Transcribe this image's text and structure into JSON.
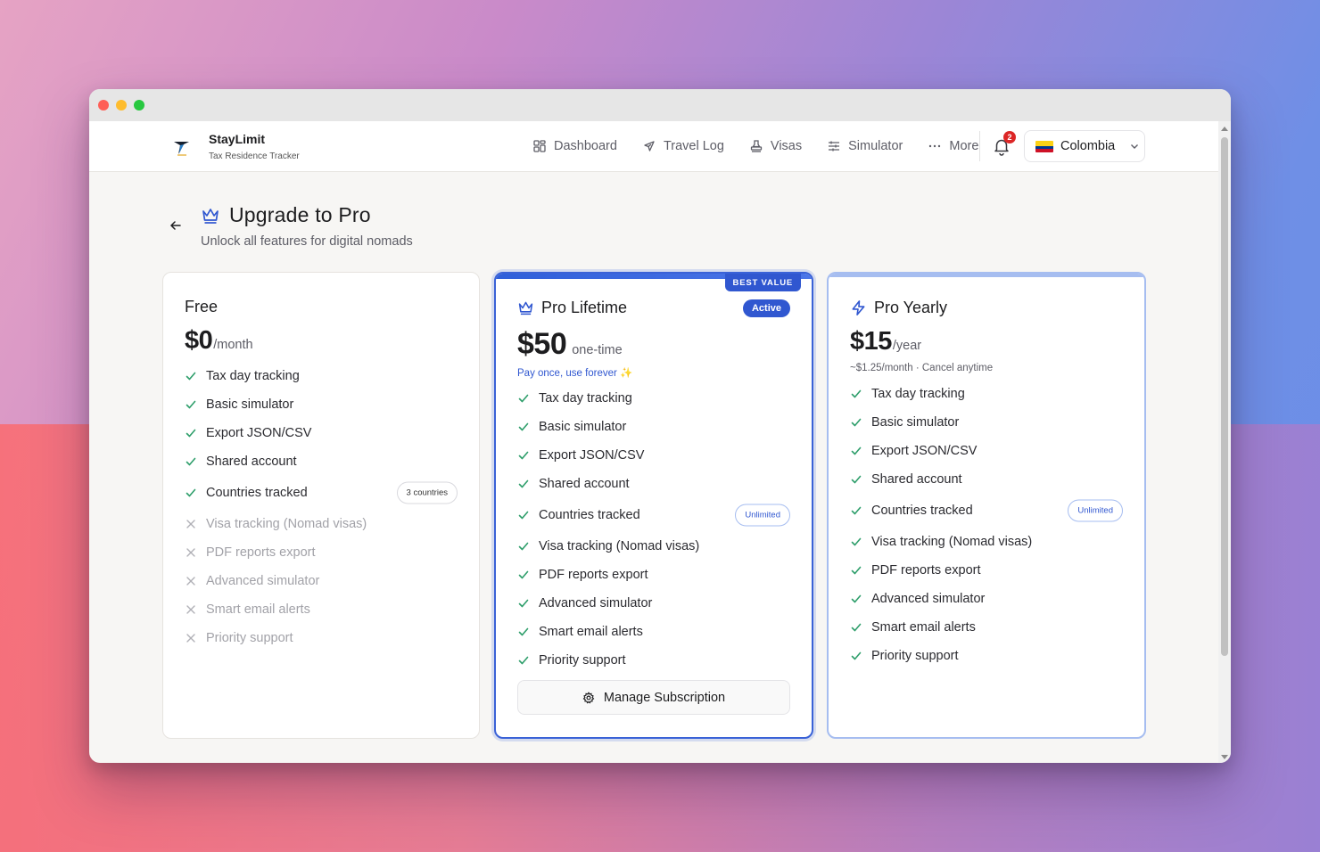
{
  "app": {
    "name": "StayLimit",
    "subtitle": "Tax Residence Tracker"
  },
  "nav": {
    "items": [
      {
        "label": "Dashboard",
        "icon": "dashboard-icon"
      },
      {
        "label": "Travel Log",
        "icon": "plane-icon"
      },
      {
        "label": "Visas",
        "icon": "stamp-icon"
      },
      {
        "label": "Simulator",
        "icon": "sliders-icon"
      },
      {
        "label": "More",
        "icon": "more-icon"
      }
    ],
    "notification_count": "2",
    "country": "Colombia"
  },
  "page": {
    "title": "Upgrade to Pro",
    "subtitle": "Unlock all features for digital nomads"
  },
  "plans": {
    "free": {
      "name": "Free",
      "price": "$0",
      "unit": "/month",
      "features": [
        {
          "label": "Tax day tracking",
          "included": true
        },
        {
          "label": "Basic simulator",
          "included": true
        },
        {
          "label": "Export JSON/CSV",
          "included": true
        },
        {
          "label": "Shared account",
          "included": true
        },
        {
          "label": "Countries tracked",
          "included": true,
          "badge": "3 countries"
        },
        {
          "label": "Visa tracking (Nomad visas)",
          "included": false
        },
        {
          "label": "PDF reports export",
          "included": false
        },
        {
          "label": "Advanced simulator",
          "included": false
        },
        {
          "label": "Smart email alerts",
          "included": false
        },
        {
          "label": "Priority support",
          "included": false
        }
      ]
    },
    "lifetime": {
      "ribbon": "BEST VALUE",
      "name": "Pro Lifetime",
      "status": "Active",
      "price": "$50",
      "unit": "one-time",
      "note": "Pay once, use forever ✨",
      "features": [
        {
          "label": "Tax day tracking",
          "included": true
        },
        {
          "label": "Basic simulator",
          "included": true
        },
        {
          "label": "Export JSON/CSV",
          "included": true
        },
        {
          "label": "Shared account",
          "included": true
        },
        {
          "label": "Countries tracked",
          "included": true,
          "badge": "Unlimited"
        },
        {
          "label": "Visa tracking (Nomad visas)",
          "included": true
        },
        {
          "label": "PDF reports export",
          "included": true
        },
        {
          "label": "Advanced simulator",
          "included": true
        },
        {
          "label": "Smart email alerts",
          "included": true
        },
        {
          "label": "Priority support",
          "included": true
        }
      ],
      "button": "Manage Subscription"
    },
    "yearly": {
      "name": "Pro Yearly",
      "price": "$15",
      "unit": "/year",
      "note": "~$1.25/month · Cancel anytime",
      "features": [
        {
          "label": "Tax day tracking",
          "included": true
        },
        {
          "label": "Basic simulator",
          "included": true
        },
        {
          "label": "Export JSON/CSV",
          "included": true
        },
        {
          "label": "Shared account",
          "included": true
        },
        {
          "label": "Countries tracked",
          "included": true,
          "badge": "Unlimited"
        },
        {
          "label": "Visa tracking (Nomad visas)",
          "included": true
        },
        {
          "label": "PDF reports export",
          "included": true
        },
        {
          "label": "Advanced simulator",
          "included": true
        },
        {
          "label": "Smart email alerts",
          "included": true
        },
        {
          "label": "Priority support",
          "included": true
        }
      ]
    }
  },
  "colors": {
    "accent": "#3057d0",
    "check": "#2e9e6b",
    "cross": "#b0b0b6"
  }
}
